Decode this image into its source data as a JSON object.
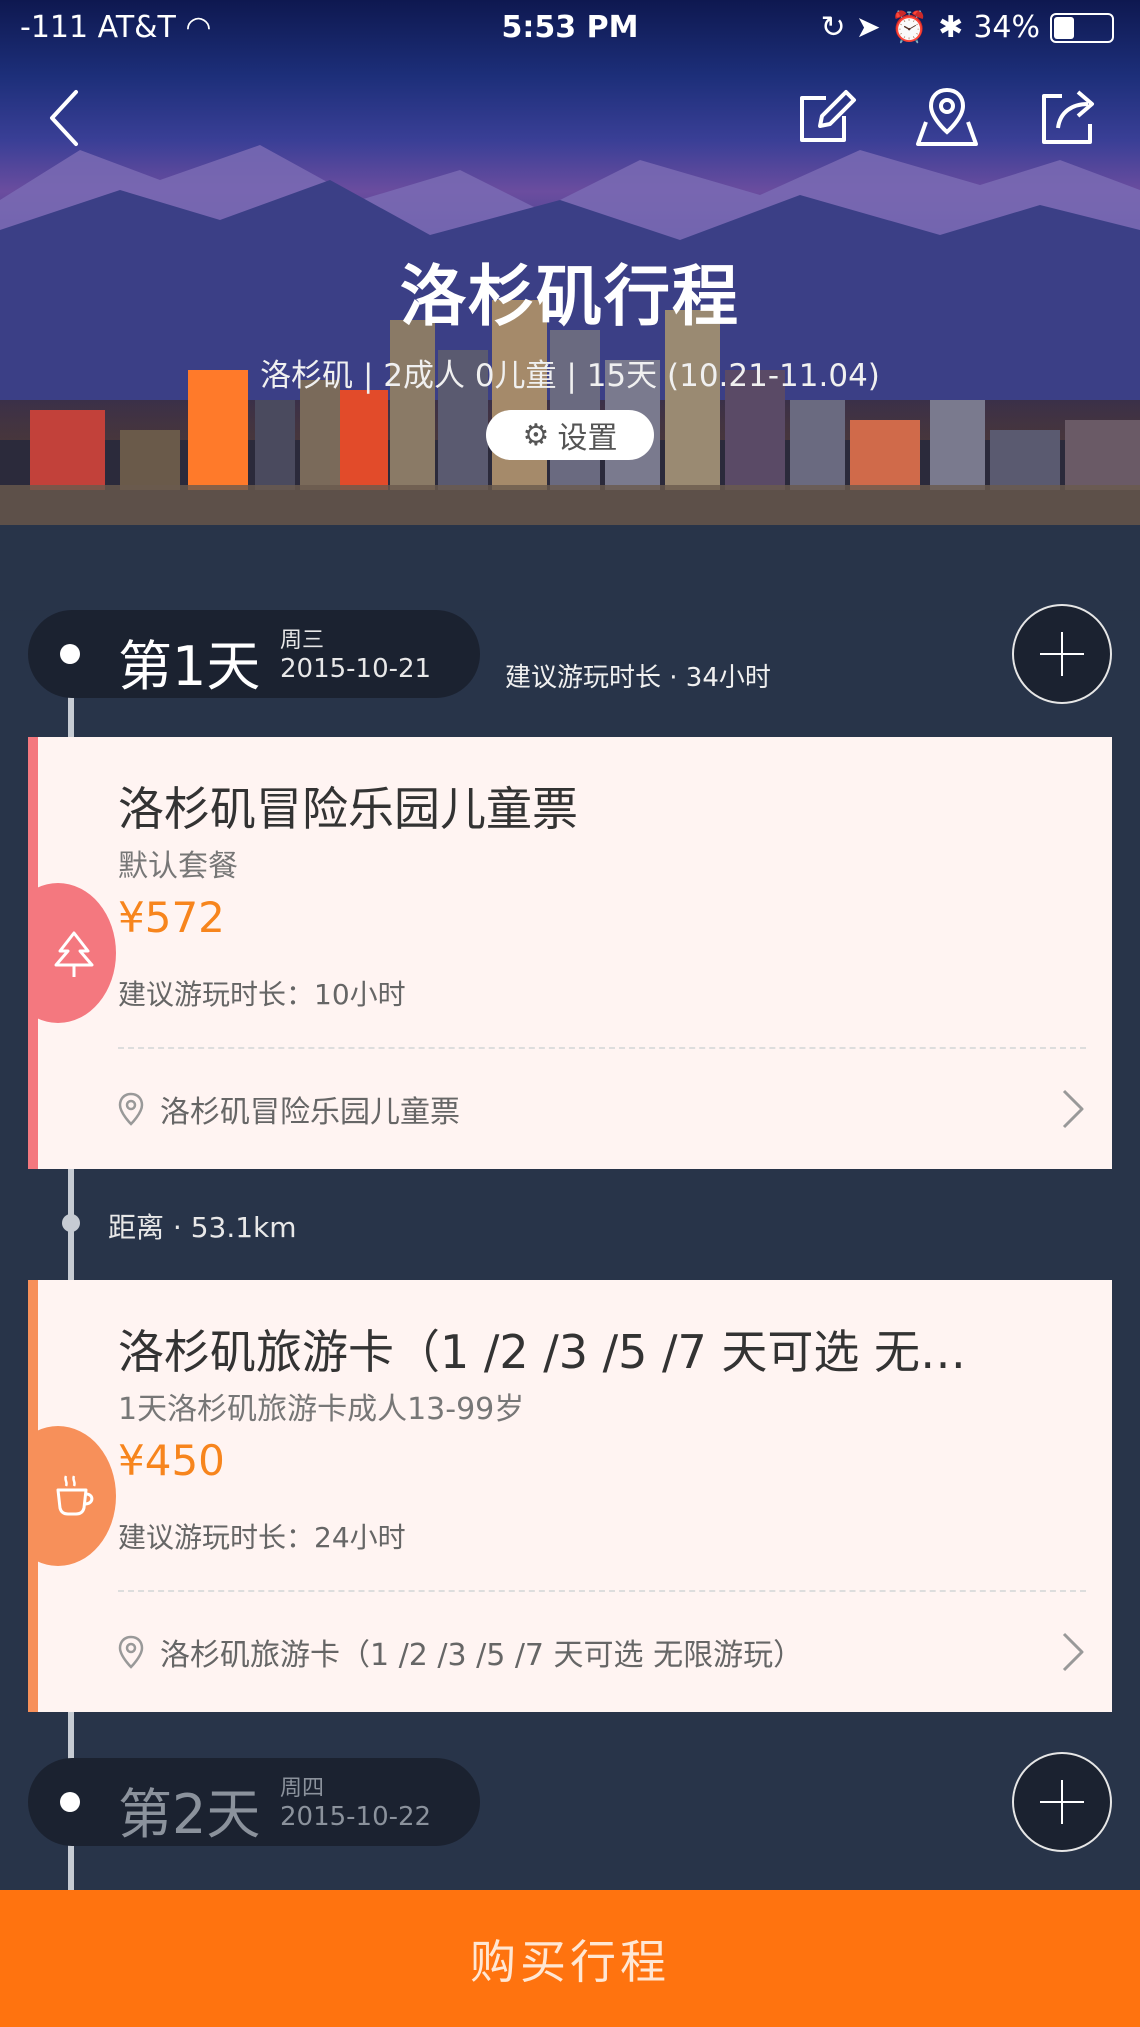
{
  "status_bar": {
    "carrier": "-111 AT&T",
    "time": "5:53 PM",
    "battery": "34%"
  },
  "header": {
    "title": "洛杉矶行程",
    "subtitle": "洛杉矶 | 2成人 0儿童 | 15天 (10.21-11.04)",
    "settings_label": "设置"
  },
  "days": [
    {
      "label": "第1天",
      "weekday": "周三",
      "date": "2015-10-21",
      "suggested_duration": "建议游玩时长 · 34小时",
      "items": [
        {
          "icon": "tree-icon",
          "accent": "#f4787f",
          "title": "洛杉矶冒险乐园儿童票",
          "package": "默认套餐",
          "price": "¥572",
          "duration": "建议游玩时长：10小时",
          "location": "洛杉矶冒险乐园儿童票"
        },
        {
          "icon": "coffee-icon",
          "accent": "#f7905a",
          "title": "洛杉矶旅游卡（1 /2 /3 /5 /7 天可选 无…",
          "package": "1天洛杉矶旅游卡成人13-99岁",
          "price": "¥450",
          "duration": "建议游玩时长：24小时",
          "location": "洛杉矶旅游卡（1 /2 /3 /5 /7 天可选 无限游玩）"
        }
      ],
      "distance": "距离 · 53.1km"
    },
    {
      "label": "第2天",
      "weekday": "周四",
      "date": "2015-10-22"
    }
  ],
  "footer": {
    "buy_label": "购买行程"
  },
  "colors": {
    "accent_orange": "#ff730f",
    "price_orange": "#f7851d",
    "background": "#283449"
  }
}
